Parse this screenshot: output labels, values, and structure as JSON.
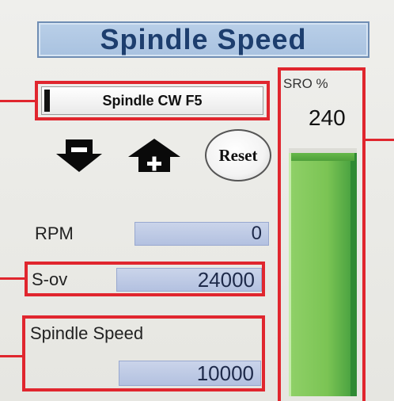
{
  "panel": {
    "title": "Spindle Speed"
  },
  "controls": {
    "spindle_button": "Spindle CW F5",
    "decrease_icon": "arrow-down-minus-icon",
    "increase_icon": "arrow-up-plus-icon",
    "reset_label": "Reset"
  },
  "readouts": {
    "rpm_label": "RPM",
    "rpm_value": "0",
    "sov_label": "S-ov",
    "sov_value": "24000",
    "speed_label": "Spindle Speed",
    "speed_value": "10000"
  },
  "sro": {
    "label": "SRO %",
    "value": "240",
    "fill_fraction": 1.0
  },
  "colors": {
    "highlight": "#e0262e",
    "title_bg": "#b3c9e4",
    "field_bg": "#bfcae6",
    "bar_green": "#7bc454"
  }
}
